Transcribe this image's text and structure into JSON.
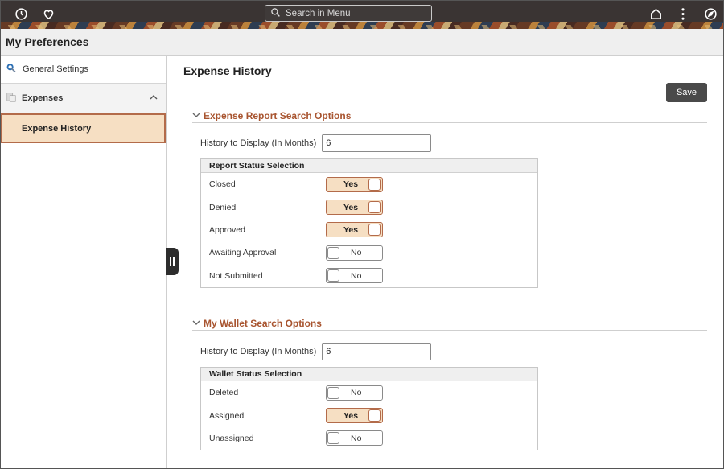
{
  "topbar": {
    "search_placeholder": "Search in Menu"
  },
  "titlebar": {
    "title": "My Preferences"
  },
  "sidebar": {
    "general_settings": "General Settings",
    "expenses": "Expenses",
    "expense_history": "Expense History"
  },
  "main": {
    "title": "Expense History",
    "save_label": "Save",
    "report_section": {
      "header": "Expense Report Search Options",
      "history_label": "History to Display (In Months)",
      "history_value": "6",
      "box_title": "Report Status Selection",
      "rows": [
        {
          "label": "Closed",
          "toggle": "Yes",
          "on": true
        },
        {
          "label": "Denied",
          "toggle": "Yes",
          "on": true
        },
        {
          "label": "Approved",
          "toggle": "Yes",
          "on": true
        },
        {
          "label": "Awaiting Approval",
          "toggle": "No",
          "on": false
        },
        {
          "label": "Not Submitted",
          "toggle": "No",
          "on": false
        }
      ]
    },
    "wallet_section": {
      "header": "My Wallet Search Options",
      "history_label": "History to Display (In Months)",
      "history_value": "6",
      "box_title": "Wallet Status Selection",
      "rows": [
        {
          "label": "Deleted",
          "toggle": "No",
          "on": false
        },
        {
          "label": "Assigned",
          "toggle": "Yes",
          "on": true
        },
        {
          "label": "Unassigned",
          "toggle": "No",
          "on": false
        }
      ]
    }
  },
  "colors": {
    "accent": "#a8542f",
    "toggle_on_bg": "#f6dfc3",
    "toggle_on_border": "#b36b4a",
    "banner": "#3a3433"
  }
}
